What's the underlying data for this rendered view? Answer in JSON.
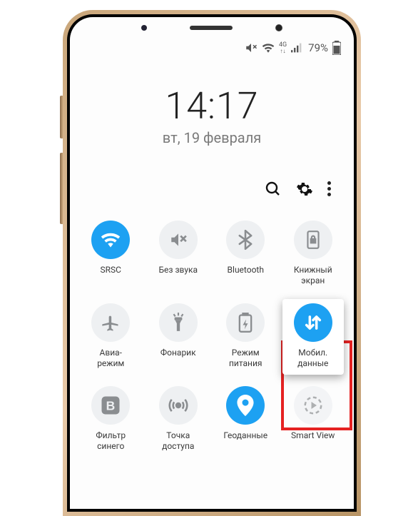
{
  "status": {
    "network_label": "4G",
    "battery_pct": "79%"
  },
  "clock": {
    "time": "14:17",
    "date": "вт, 19 февраля"
  },
  "tiles": [
    {
      "label": "SRSC"
    },
    {
      "label": "Без звука"
    },
    {
      "label": "Bluetooth"
    },
    {
      "label": "Книжный\nэкран"
    },
    {
      "label": "Авиа-\nрежим"
    },
    {
      "label": "Фонарик"
    },
    {
      "label": "Режим\nпитания"
    },
    {
      "label": "Мобил.\nданные"
    },
    {
      "label": "Фильтр\nсинего"
    },
    {
      "label": "Точка\nдоступа"
    },
    {
      "label": "Геоданные"
    },
    {
      "label": "Smart View"
    }
  ]
}
